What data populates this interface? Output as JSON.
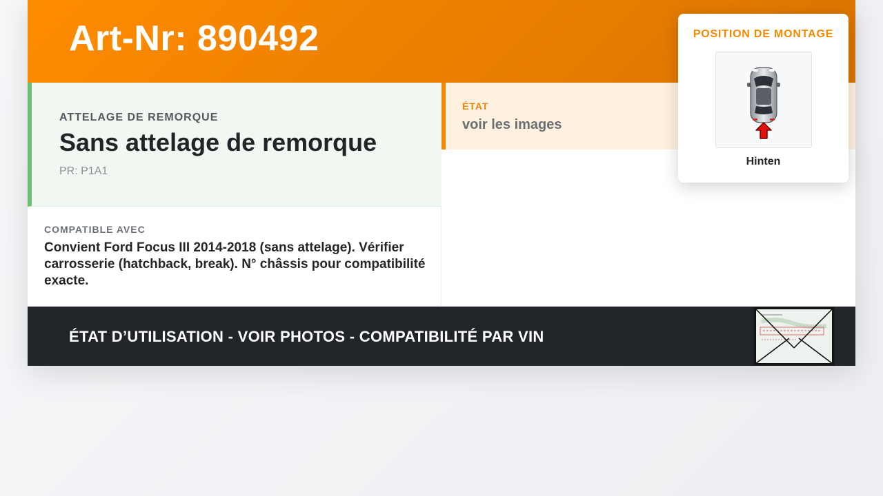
{
  "header": {
    "art_nr": "Art-Nr: 890492"
  },
  "tow": {
    "label": "ATTELAGE DE REMORQUE",
    "value": "Sans attelage de remorque",
    "pr": "PR: P1A1"
  },
  "compat": {
    "label": "COMPATIBLE AVEC",
    "text": "Convient Ford Focus III 2014-2018 (sans attelage). Vérifier carrosserie (hatchback, break). N° châssis pour compatibilité exacte."
  },
  "etat": {
    "label": "ÉTAT",
    "value": "voir les images"
  },
  "mount": {
    "title": "POSITION DE MONTAGE",
    "caption": "Hinten",
    "icon": "car-top-view-rear-arrow-icon"
  },
  "footer": {
    "text": "ÉTAT D’UTILISATION - VOIR PHOTOS - COMPATIBILITÉ PAR VIN",
    "thumb_icon": "vin-plate-placeholder-icon"
  },
  "colors": {
    "accent_orange": "#f08a00",
    "green_border": "#6cc070",
    "footer_bg": "#212429",
    "arrow_red": "#e01010"
  }
}
